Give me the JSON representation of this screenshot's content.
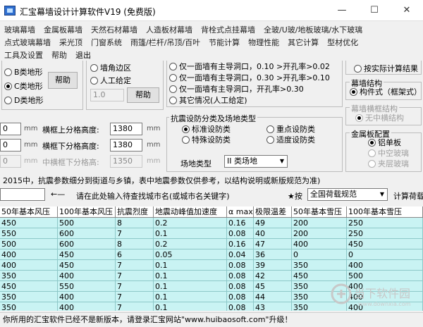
{
  "window": {
    "title": "汇宝幕墙设计计算软件V19    (免费版)"
  },
  "menu": {
    "row1": [
      "玻璃幕墙",
      "金属板幕墙",
      "天然石材幕墙",
      "人造板材幕墙",
      "背栓式点挂幕墙",
      "全玻/U玻/地板玻璃/水下玻璃"
    ],
    "row2": [
      "点式玻璃幕墙",
      "采光顶",
      "门窗系统",
      "雨篷/栏杆/吊顶/百叶",
      "节能计算",
      "物理性能",
      "其它计算",
      "型材优化"
    ],
    "row3": [
      "工具及设置",
      "帮助",
      "退出"
    ]
  },
  "shape": {
    "b": "B类地形",
    "c": "C类地形",
    "d": "D类地形",
    "help": "帮助"
  },
  "wall": {
    "corner": "墙角边区",
    "manual": "人工给定",
    "value": "1.0",
    "help": "帮助"
  },
  "opening": {
    "opt1": "仅一面墙有主导洞口，0.10 >开孔率>0.02",
    "opt2": "仅一面墙有主导洞口，0.30 >开孔率>0.10",
    "opt3": "仅一面墙有主导洞口，开孔率>0.30",
    "opt4": "其它情况(人工给定)"
  },
  "calc": {
    "actual": "按实际计算结果"
  },
  "structure": {
    "title": "幕墙结构",
    "option": "构件式（框架式）"
  },
  "mullion": {
    "title": "幕墙横框结构",
    "option": "无中横结构"
  },
  "panel": {
    "title": "金属板配置",
    "aluminum": "铝单板",
    "hollow": "中空玻璃",
    "laminated": "夹层玻璃"
  },
  "frame": {
    "v1": "0",
    "v2": "0",
    "v3": "0",
    "unit": "mm",
    "upper_label": "横框上分格高度:",
    "upper_value": "1380",
    "lower_label": "横框下分格高度:",
    "lower_value": "1380",
    "mid_label": "中横框下分格高:",
    "mid_value": "1350"
  },
  "seismic": {
    "title": "抗震设防分类及场地类型",
    "standard": "标准设防类",
    "key": "重点设防类",
    "special": "特殊设防类",
    "moderate": "适度设防类",
    "site_label": "场地类型",
    "site_value": "II 类场地"
  },
  "notice": "2015中，抗震参数细分到街道与乡镇，表中地震参数仅供参考，以结构说明或新版规范为准)",
  "search": {
    "arrow": "←—",
    "hint": "请在此处输入待查找城市名(或城市名关键字)",
    "star": "★按",
    "load_value": "全国荷载规范",
    "calc_label": "计算荷载"
  },
  "table": {
    "headers": [
      "50年基本风压",
      "100年基本风压",
      "抗震烈度",
      "地震动峰值加速度",
      "α max",
      "极限温差",
      "50年基本雪压",
      "100年基本雪压"
    ],
    "rows": [
      [
        "450",
        "500",
        "8",
        "0.2",
        "0.16",
        "49",
        "200",
        "250"
      ],
      [
        "550",
        "600",
        "7",
        "0.1",
        "0.08",
        "40",
        "200",
        "250"
      ],
      [
        "500",
        "600",
        "8",
        "0.2",
        "0.16",
        "47",
        "400",
        "450"
      ],
      [
        "400",
        "450",
        "6",
        "0.05",
        "0.04",
        "36",
        "0",
        "0"
      ],
      [
        "400",
        "450",
        "7",
        "0.1",
        "0.08",
        "39",
        "350",
        "400"
      ],
      [
        "350",
        "400",
        "7",
        "0.1",
        "0.08",
        "42",
        "450",
        "500"
      ],
      [
        "450",
        "550",
        "7",
        "0.1",
        "0.08",
        "45",
        "350",
        "400"
      ],
      [
        "350",
        "400",
        "7",
        "0.1",
        "0.08",
        "44",
        "350",
        "400"
      ],
      [
        "350",
        "400",
        "7",
        "0.1",
        "0.08",
        "43",
        "350",
        "400"
      ]
    ]
  },
  "status": "你所用的汇宝软件已经不是新版本，请登录汇宝网站\"www.huibaosoft.com\"升级！",
  "watermark": {
    "main": "当下软件园",
    "sub": "www.downxia.com"
  }
}
